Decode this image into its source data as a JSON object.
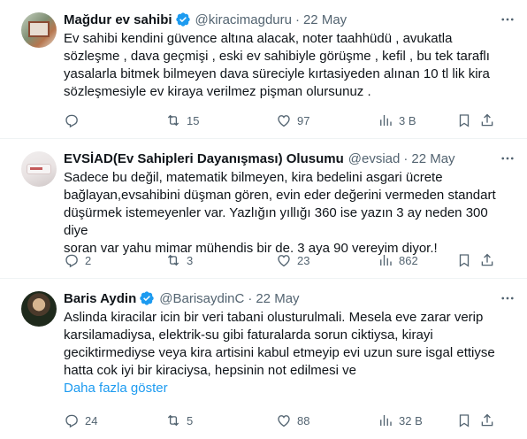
{
  "tweets": [
    {
      "name": "Mağdur ev sahibi",
      "handle": "@kiracimagduru",
      "separator": "·",
      "time": "22 May",
      "lines": [
        "Ev sahibi kendini güvence altına alacak,  noter taahhüdü , avukatla",
        "sözleşme , dava geçmişi , eski ev sahibiyle görüşme , kefil , bu tek taraflı",
        "yasalarla bitmek bilmeyen dava süreciyle kırtasiyeden alınan 10 tl lik kira",
        "sözleşmesiyle ev kiraya verilmez pişman olursunuz ."
      ],
      "replies": "",
      "retweets": "15",
      "likes": "97",
      "views": "3 B",
      "verified": true
    },
    {
      "name": "EVSİAD(Ev Sahipleri Dayanışması) Olusumu",
      "handle": "@evsiad",
      "separator": "·",
      "time": "22 May",
      "lines": [
        "Sadece bu değil, matematik bilmeyen, kira bedelini asgari ücrete",
        "bağlayan,evsahibini düşman gören, evin eder değerini vermeden standart",
        "düşürmek istemeyenler var. Yazlığın yıllığı 360 ise yazın 3 ay neden 300 diye",
        "soran var yahu mimar mühendis bir de. 3 aya 90 vereyim diyor.!"
      ],
      "replies": "2",
      "retweets": "3",
      "likes": "23",
      "views": "862",
      "verified": false
    },
    {
      "name": "Baris Aydin",
      "handle": "@BarisaydinC",
      "separator": "·",
      "time": "22 May",
      "lines": [
        "Aslinda kiracilar icin bir veri tabani olusturulmali. Mesela eve zarar verip",
        "karsilamadiysa, elektrik-su gibi faturalarda sorun ciktiysa, kirayi",
        "geciktirmediyse veya kira artisini kabul etmeyip evi uzun sure isgal ettiyse",
        "hatta cok iyi bir kiraciysa, hepsinin not edilmesi ve"
      ],
      "show_more": "Daha fazla göster",
      "replies": "24",
      "retweets": "5",
      "likes": "88",
      "views": "32 B",
      "verified": true
    }
  ],
  "colors": {
    "text": "#0f1419",
    "secondary": "#536471",
    "link": "#1d9bf0",
    "divider": "#eff3f4",
    "verified": "#1d9bf0"
  },
  "icons": [
    "more-icon",
    "reply-icon",
    "retweet-icon",
    "like-icon",
    "views-icon",
    "bookmark-icon",
    "share-icon",
    "verified-badge-icon"
  ]
}
